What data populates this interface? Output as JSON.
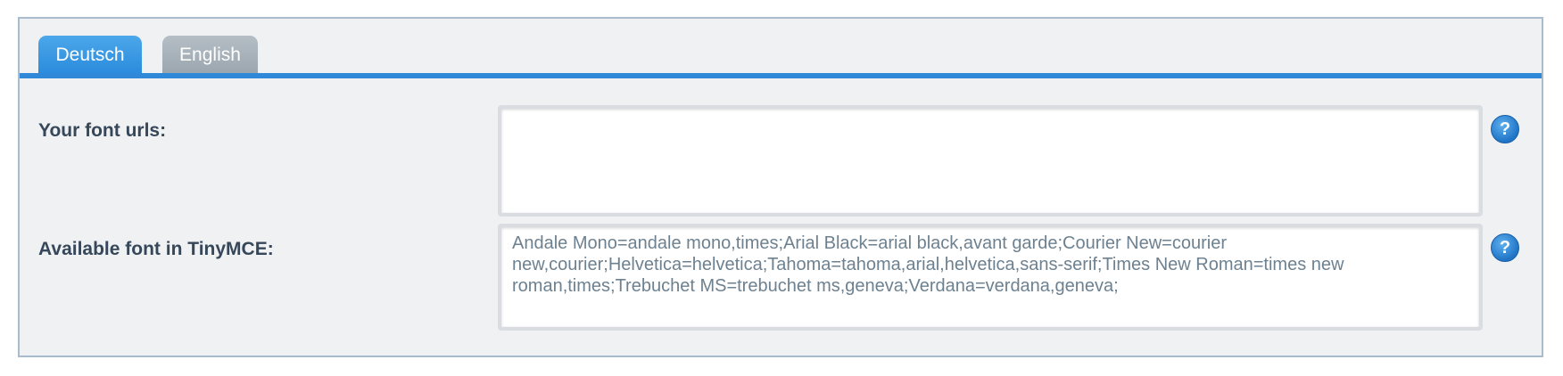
{
  "tabs": [
    {
      "label": "Deutsch",
      "active": true
    },
    {
      "label": "English",
      "active": false
    }
  ],
  "fields": {
    "font_urls": {
      "label": "Your font urls:",
      "value": "",
      "help_icon": "question-mark-icon"
    },
    "tinymce_fonts": {
      "label": "Available font in TinyMCE:",
      "value": "Andale Mono=andale mono,times;Arial Black=arial black,avant garde;Courier New=courier new,courier;Helvetica=helvetica;Tahoma=tahoma,arial,helvetica,sans-serif;Times New Roman=times new roman,times;Trebuchet MS=trebuchet ms,geneva;Verdana=verdana,geneva;",
      "help_icon": "question-mark-icon"
    }
  },
  "help_symbol": "?",
  "colors": {
    "accent": "#2f88d8",
    "active_tab": "#3a9be4",
    "inactive_tab": "#a5afb8",
    "panel_bg": "#eff1f3",
    "label_text": "#37475a",
    "field_text": "#6d8190",
    "help_icon": "#2a84d3"
  }
}
